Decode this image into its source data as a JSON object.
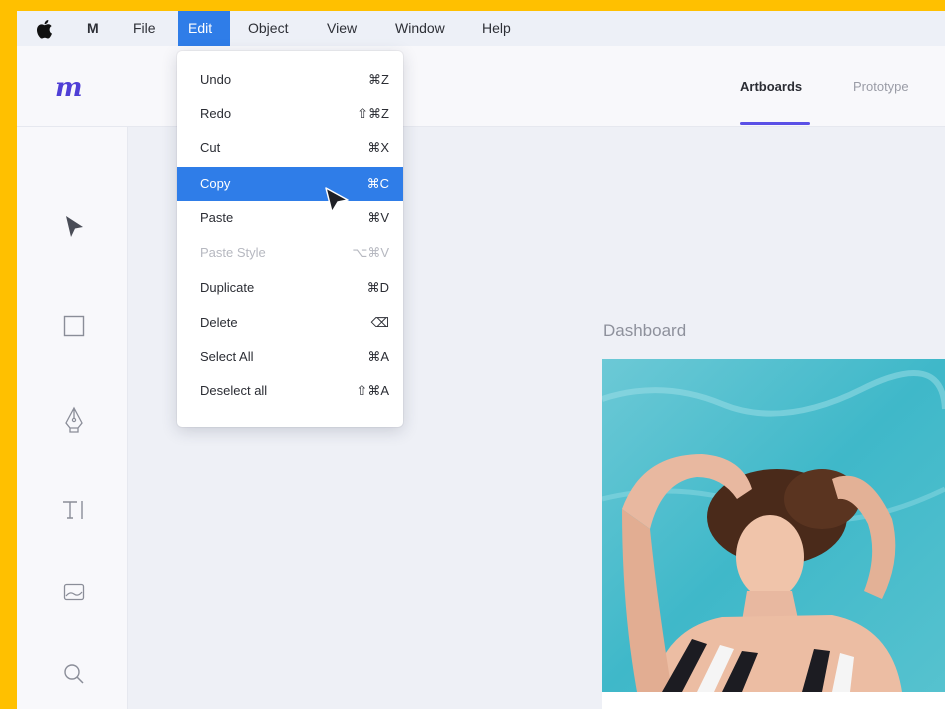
{
  "menubar": {
    "app_name": "M",
    "items": [
      "File",
      "Edit",
      "Object",
      "View",
      "Window",
      "Help"
    ],
    "active": "Edit"
  },
  "header": {
    "logo": "m",
    "tabs": [
      "Artboards",
      "Prototype"
    ],
    "active_tab": "Artboards"
  },
  "tools": [
    "select-tool",
    "rectangle-tool",
    "pen-tool",
    "text-tool",
    "image-tool",
    "zoom-tool"
  ],
  "canvas": {
    "artboard_title": "Dashboard"
  },
  "edit_menu": {
    "items": [
      {
        "label": "Undo",
        "shortcut": "⌘Z"
      },
      {
        "label": "Redo",
        "shortcut": "⇧⌘Z"
      },
      {
        "label": "Cut",
        "shortcut": "⌘X"
      },
      {
        "label": "Copy",
        "shortcut": "⌘C"
      },
      {
        "label": "Paste",
        "shortcut": "⌘V"
      },
      {
        "label": "Paste Style",
        "shortcut": "⌥⌘V"
      },
      {
        "label": "Duplicate",
        "shortcut": "⌘D"
      },
      {
        "label": "Delete",
        "shortcut": "⌫"
      },
      {
        "label": "Select All",
        "shortcut": "⌘A"
      },
      {
        "label": "Deselect all",
        "shortcut": "⇧⌘A"
      }
    ],
    "highlighted": "Copy",
    "disabled": [
      "Paste Style"
    ]
  },
  "colors": {
    "frame": "#ffc000",
    "accent": "#2f7de8",
    "tab_underline": "#5a50e6",
    "logo": "#4f3fd6"
  }
}
